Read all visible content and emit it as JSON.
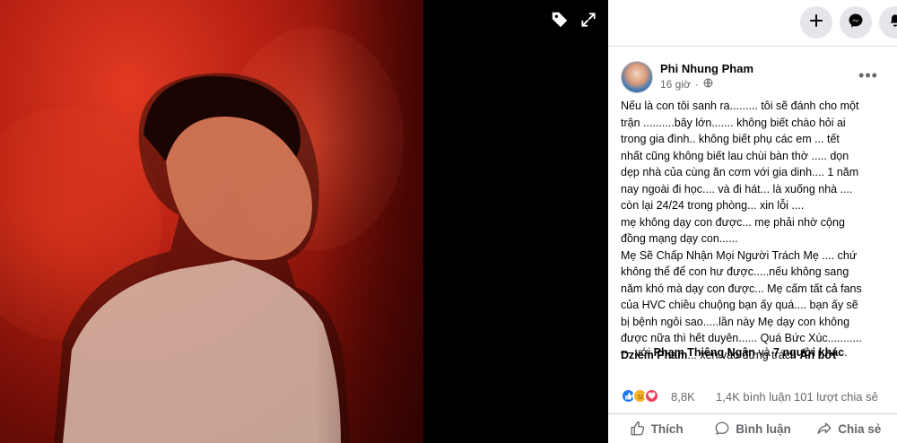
{
  "viewer": {
    "tag_icon": "tag-icon",
    "expand_icon": "expand-icon"
  },
  "topbar": {
    "create_icon": "plus-icon",
    "messenger_icon": "messenger-icon",
    "notifications_icon": "bell-icon"
  },
  "post": {
    "author": "Phi Nhung Pham",
    "time": "16 giờ",
    "privacy_icon": "globe-icon",
    "more_label": "•••",
    "lines": [
      "Nếu là con tôi sanh ra......... tôi sẽ đánh cho một",
      "trận ..........bây lớn....... không biết chào hỏi ai",
      "trong gia đình.. không biết phụ các em ... tết",
      "nhất cũng không biết lau chùi bàn thờ ..... dọn",
      "dẹp nhà của cùng ăn cơm với gia dinh.... 1 năm",
      "nay ngoài đi học.... và đi hát... là xuống nhà ....",
      "còn lại 24/24 trong phòng... xin lỗi ....",
      "mẹ không dạy con được... mẹ phải nhờ cộng",
      "đồng mạng dạy con......",
      "Mẹ Sẽ Chấp Nhận Mọi Người Trách Mẹ .... chứ",
      "không thể để con hư được.....nếu không sang",
      "năm khó mà dạy con được... Mẹ cấm tất cả fans",
      "của HVC chiều chuộng bạn ấy quá.... bạn ấy sẽ",
      "bị bệnh ngôi sao.....lần này Mẹ dạy con không",
      "được nữa thì hết duyên...... Quá Bức Xúc..........."
    ],
    "last_line_name": "Dziem Pham",
    "last_line_text": "... xen vào đừng trách ",
    "last_line_bold": "Ẩn bớt",
    "with_prefix": "— với ",
    "with_name": "Phạm Thiêng Ngân",
    "with_and": " và ",
    "with_others": "7 người khác",
    "with_end": "."
  },
  "stats": {
    "reactions": "8,8K",
    "comments": "1,4K bình luận",
    "shares": "101 lượt chia sẻ"
  },
  "actions": {
    "like": "Thích",
    "comment": "Bình luận",
    "share": "Chia sẻ"
  },
  "colors": {
    "like_blue": "#1877f2",
    "sad_yellow": "#f7b125",
    "love_red": "#f33e58",
    "secondary_text": "#65676b"
  }
}
